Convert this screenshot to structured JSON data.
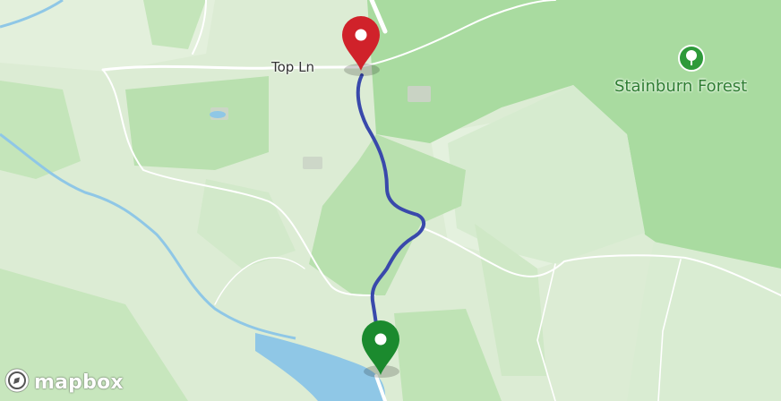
{
  "map": {
    "road_label": "Top Ln",
    "area_label": "Stainburn Forest",
    "area_icon": "tree-icon",
    "logo_text": "mapbox",
    "route_color": "#3949ab",
    "start_marker_color": "#1b8a2e",
    "end_marker_color": "#d0222a",
    "forest_color": "#a9dba0",
    "water_color": "#8fc7e6"
  }
}
